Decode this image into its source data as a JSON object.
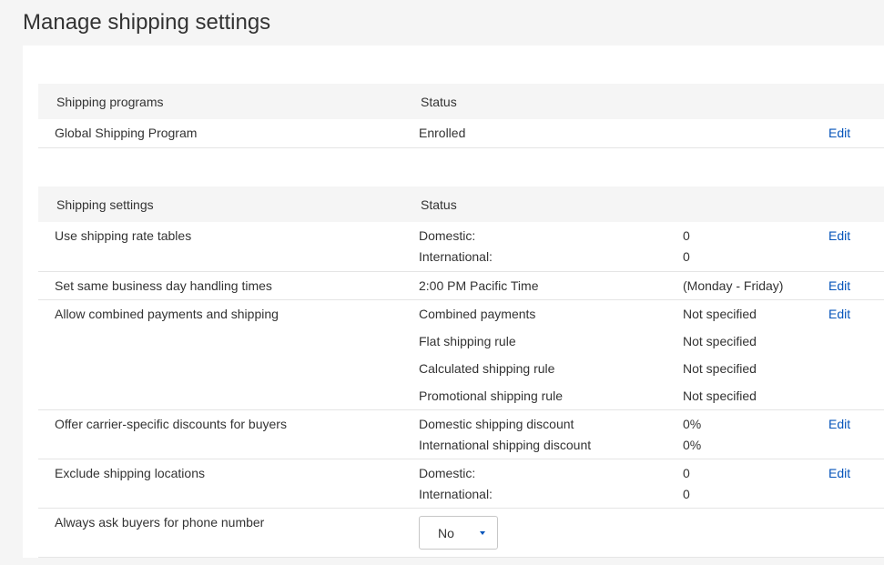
{
  "page": {
    "title": "Manage shipping settings"
  },
  "programs_table": {
    "headers": [
      "Shipping programs",
      "Status"
    ],
    "rows": [
      {
        "name": "Global Shipping Program",
        "status": "Enrolled",
        "action": "Edit"
      }
    ]
  },
  "settings_table": {
    "headers": [
      "Shipping settings",
      "Status"
    ],
    "rows": [
      {
        "name": "Use shipping rate tables",
        "lines": [
          {
            "label": "Domestic:",
            "value": "0"
          },
          {
            "label": "International:",
            "value": "0"
          }
        ],
        "action": "Edit"
      },
      {
        "name": "Set same business day handling times",
        "lines": [
          {
            "label": "2:00 PM Pacific Time",
            "value": "(Monday - Friday)"
          }
        ],
        "action": "Edit"
      },
      {
        "name": "Allow combined payments and shipping",
        "lines": [
          {
            "label": "Combined payments",
            "value": "Not specified"
          },
          {
            "label": "Flat shipping rule",
            "value": "Not specified"
          },
          {
            "label": "Calculated shipping rule",
            "value": "Not specified"
          },
          {
            "label": "Promotional shipping rule",
            "value": "Not specified"
          }
        ],
        "action": "Edit"
      },
      {
        "name": "Offer carrier-specific discounts for buyers",
        "lines": [
          {
            "label": "Domestic shipping discount",
            "value": "0%"
          },
          {
            "label": "International shipping discount",
            "value": "0%"
          }
        ],
        "action": "Edit"
      },
      {
        "name": "Exclude shipping locations",
        "lines": [
          {
            "label": "Domestic:",
            "value": "0"
          },
          {
            "label": "International:",
            "value": "0"
          }
        ],
        "action": "Edit"
      },
      {
        "name": "Always ask buyers for phone number",
        "select": {
          "value": "No"
        }
      }
    ]
  },
  "colors": {
    "link": "#0654ba",
    "header_bg": "#f5f5f5",
    "divider": "#e5e5e5"
  }
}
